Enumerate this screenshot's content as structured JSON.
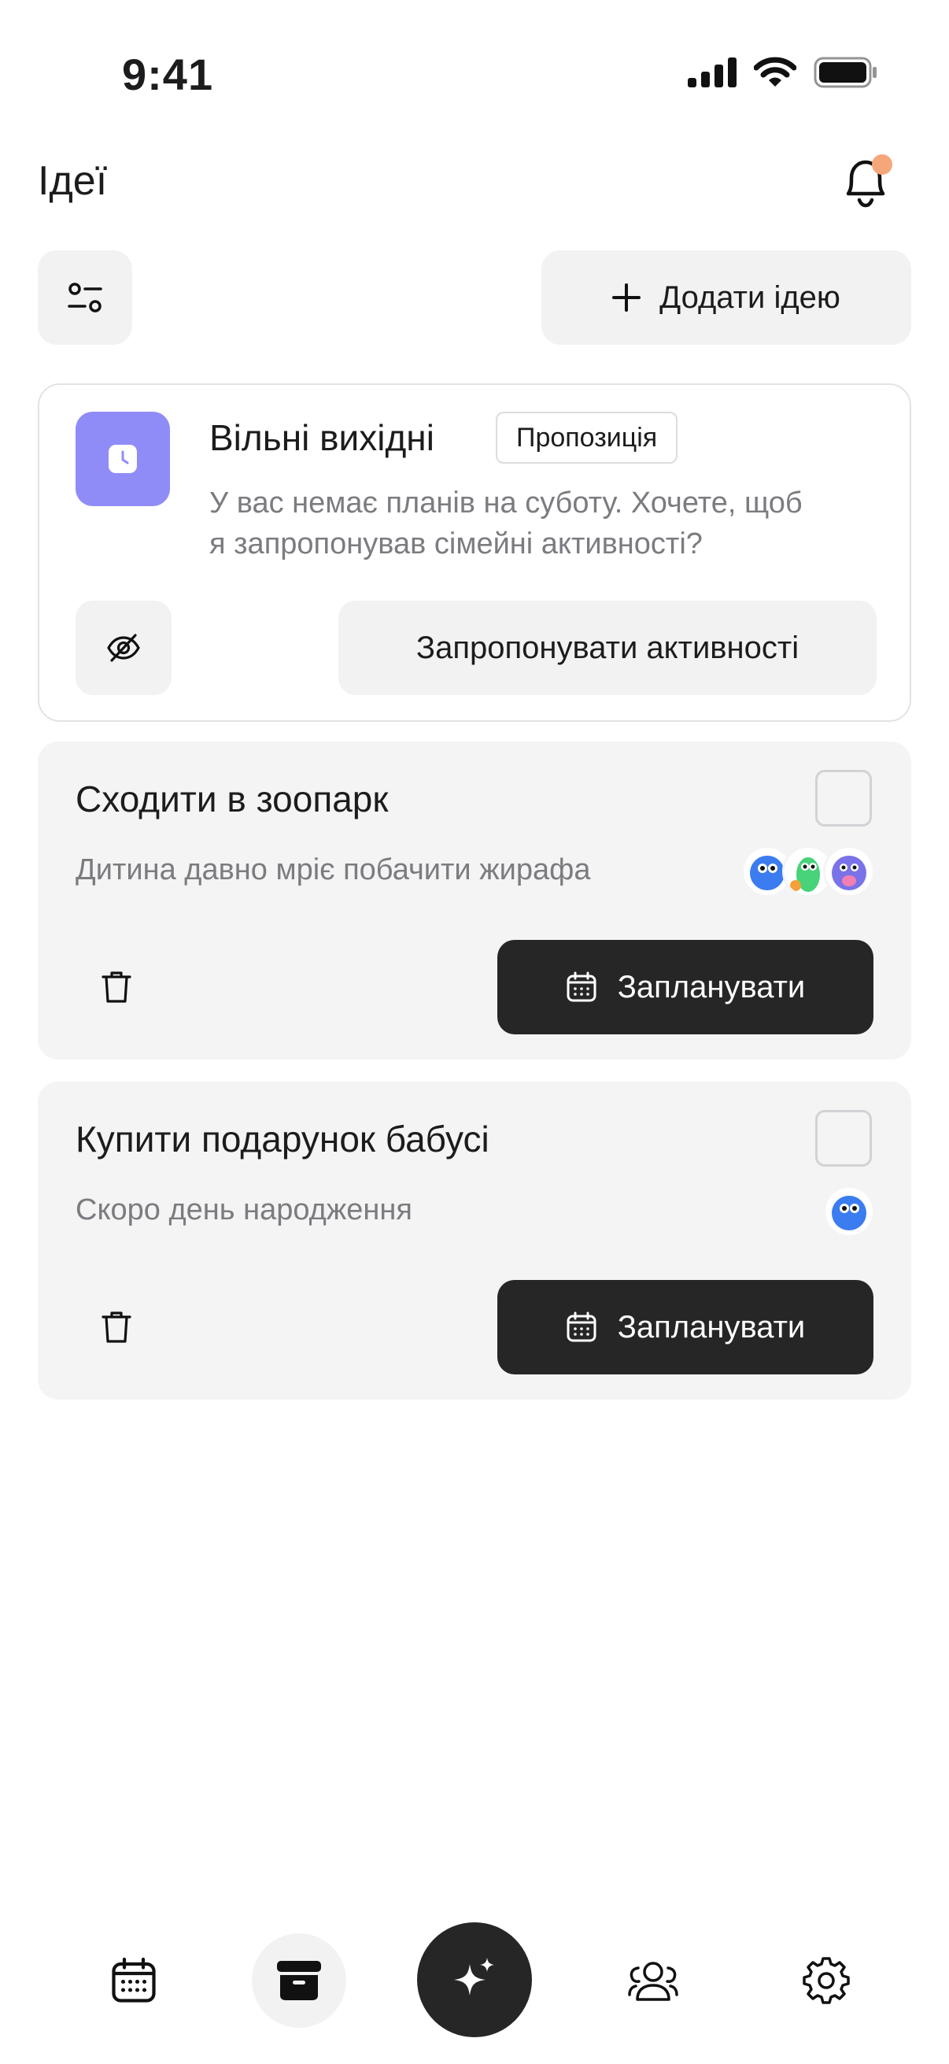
{
  "status_bar": {
    "time": "9:41"
  },
  "header": {
    "title": "Ідеї",
    "notification_badge": true
  },
  "toolbar": {
    "add_label": "Додати ідею"
  },
  "suggestion": {
    "title": "Вільні вихідні",
    "badge": "Пропозиція",
    "text_line1": "У вас немає планів на суботу. Хочете, щоб",
    "text_line2": "я запропонував сімейні активності?",
    "action_label": "Запропонувати активності"
  },
  "ideas": [
    {
      "title": "Сходити в зоопарк",
      "description": "Дитина давно мріє побачити жирафа",
      "plan_label": "Запланувати",
      "checked": false
    },
    {
      "title": "Купити подарунок бабусі",
      "description": "Скоро день народження",
      "plan_label": "Запланувати",
      "checked": false
    }
  ],
  "nav": {
    "items": [
      "calendar-icon",
      "archive-icon",
      "sparkle-icon",
      "family-icon",
      "gear-icon"
    ],
    "active": "sparkle-icon"
  },
  "colors": {
    "accent_purple": "#8f8cf7",
    "dark": "#262626",
    "badge_dot": "#f5a77a",
    "card_bg": "#f4f4f4"
  }
}
